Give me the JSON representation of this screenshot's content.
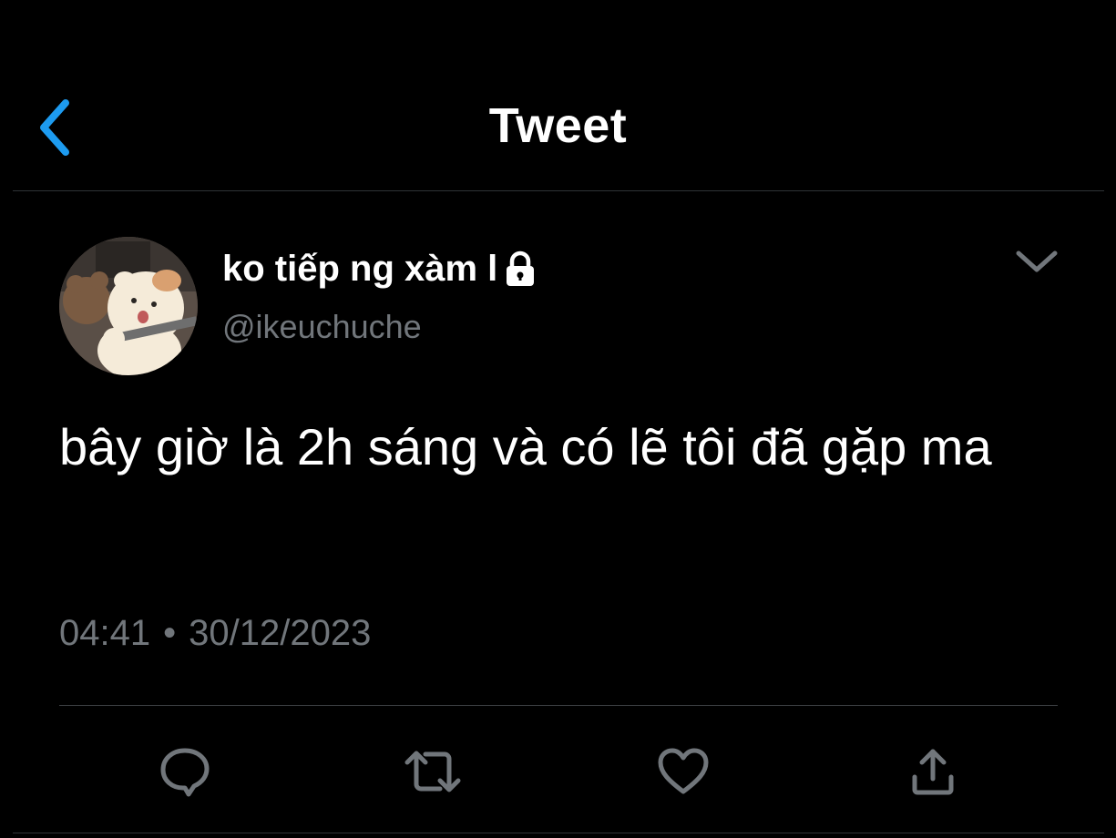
{
  "header": {
    "title": "Tweet",
    "back_icon": "chevron-left-icon"
  },
  "tweet": {
    "display_name": "ko tiếp ng xàm l",
    "handle": "@ikeuchuche",
    "text": "bây giờ là 2h sáng và có lẽ tôi đã gặp ma",
    "time": "04:41",
    "separator": "•",
    "date": "30/12/2023"
  },
  "actions": [
    {
      "name": "reply",
      "icon": "speech-bubble-icon"
    },
    {
      "name": "retweet",
      "icon": "retweet-icon"
    },
    {
      "name": "like",
      "icon": "heart-icon"
    },
    {
      "name": "share",
      "icon": "share-icon"
    }
  ],
  "colors": {
    "background": "#000000",
    "accent": "#1d9bf0",
    "secondary_text": "#71767b",
    "primary_text": "#ffffff",
    "divider": "#2f3336"
  }
}
